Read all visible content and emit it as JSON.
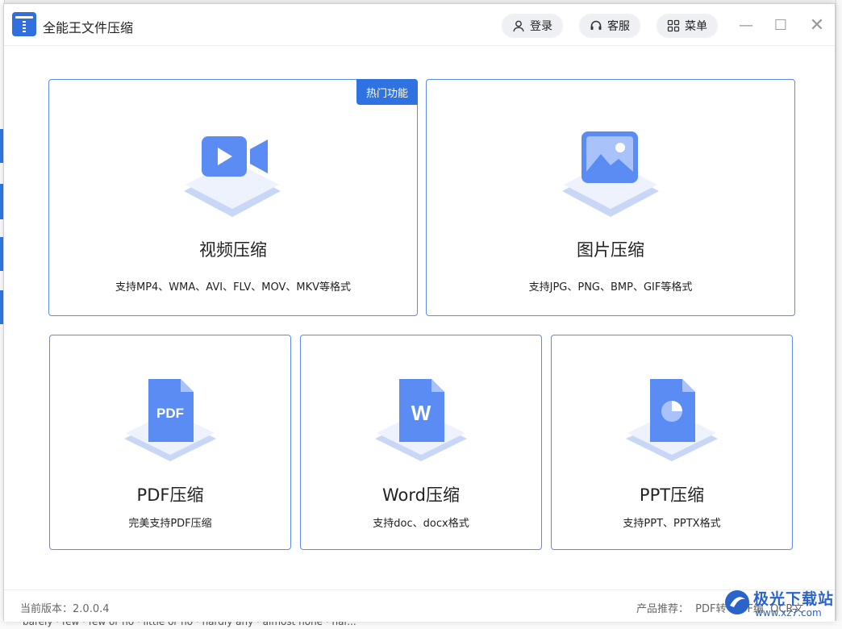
{
  "app": {
    "title": "全能王文件压缩"
  },
  "titlebar": {
    "login_label": "登录",
    "service_label": "客服",
    "menu_label": "菜单",
    "minimize_glyph": "—",
    "maximize_glyph": "☐",
    "close_glyph": "✕"
  },
  "cards": {
    "video": {
      "badge": "热门功能",
      "title": "视频压缩",
      "desc": "支持MP4、WMA、AVI、FLV、MOV、MKV等格式",
      "icon": "video-camera-icon"
    },
    "image": {
      "title": "图片压缩",
      "desc": "支持JPG、PNG、BMP、GIF等格式",
      "icon": "picture-icon"
    },
    "pdf": {
      "title": "PDF压缩",
      "desc": "完美支持PDF压缩",
      "icon_text": "PDF",
      "icon": "pdf-file-icon"
    },
    "word": {
      "title": "Word压缩",
      "desc": "支持doc、docx格式",
      "icon_text": "W",
      "icon": "word-file-icon"
    },
    "ppt": {
      "title": "PPT压缩",
      "desc": "支持PPT、PPTX格式",
      "icon": "ppt-file-icon"
    }
  },
  "footer": {
    "version_label": "当前版本：",
    "version_value": "2.0.0.4",
    "recommend_label": "产品推荐：",
    "recommend_items": [
      "PDF转",
      "PDF编",
      "OCR文"
    ]
  },
  "watermark": {
    "name": "极光下载站",
    "url": "www.xz7.com"
  },
  "background": {
    "bottom_text": "barely · few · few or no · little or no · hardly any · almost none · har..."
  },
  "colors": {
    "accent": "#2f73e2",
    "card_border": "#5b8de8",
    "icon_blue": "#4f86f7"
  }
}
